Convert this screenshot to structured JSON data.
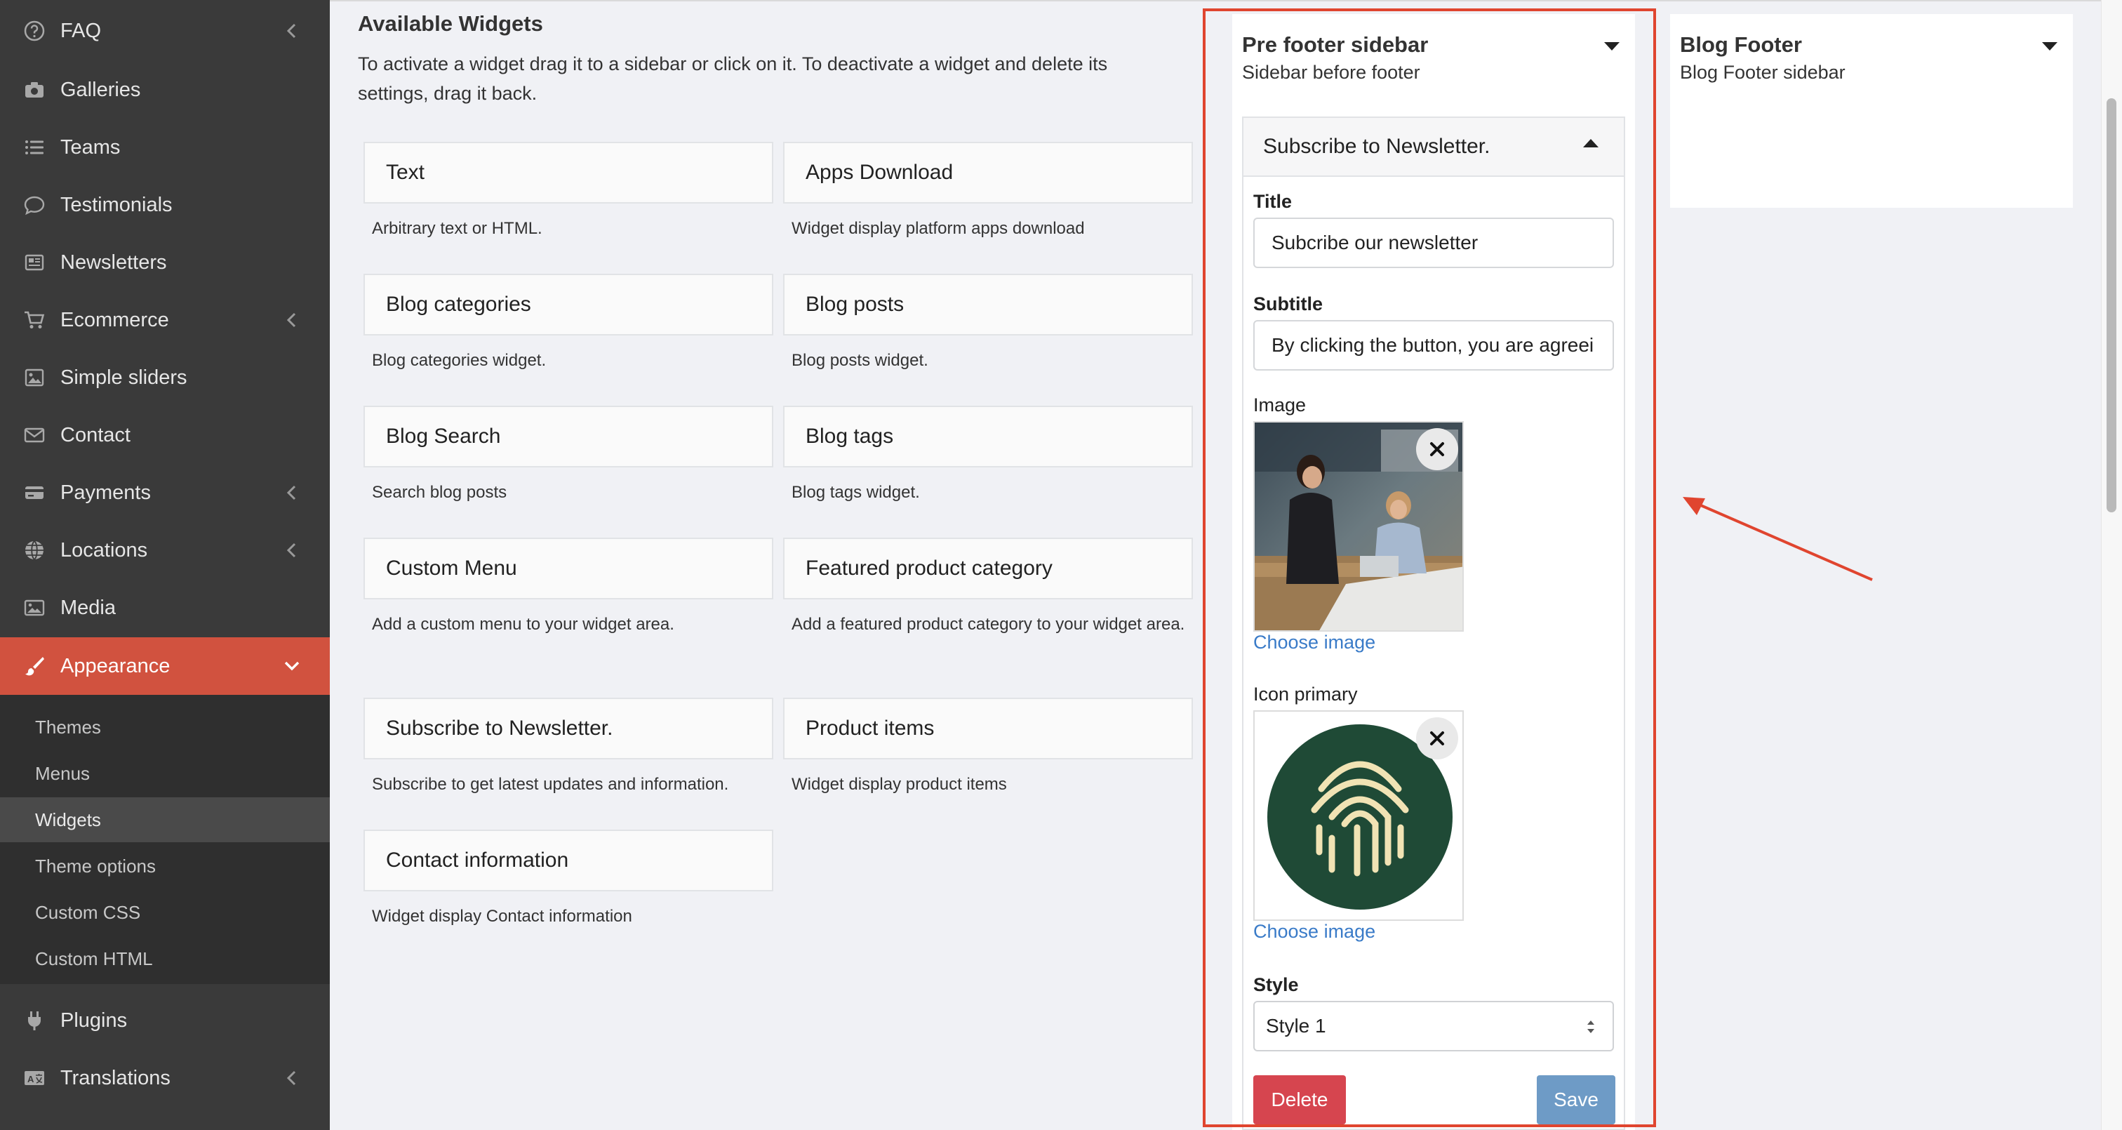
{
  "sidebar": {
    "items": [
      {
        "label": "FAQ",
        "icon": "question-circle-icon",
        "has_children": true
      },
      {
        "label": "Galleries",
        "icon": "camera-icon",
        "has_children": false
      },
      {
        "label": "Teams",
        "icon": "list-icon",
        "has_children": false
      },
      {
        "label": "Testimonials",
        "icon": "comment-icon",
        "has_children": false
      },
      {
        "label": "Newsletters",
        "icon": "newspaper-icon",
        "has_children": false
      },
      {
        "label": "Ecommerce",
        "icon": "cart-icon",
        "has_children": true
      },
      {
        "label": "Simple sliders",
        "icon": "image-icon",
        "has_children": false
      },
      {
        "label": "Contact",
        "icon": "envelope-icon",
        "has_children": false
      },
      {
        "label": "Payments",
        "icon": "credit-card-icon",
        "has_children": true
      },
      {
        "label": "Locations",
        "icon": "globe-icon",
        "has_children": true
      },
      {
        "label": "Media",
        "icon": "images-icon",
        "has_children": false
      },
      {
        "label": "Appearance",
        "icon": "paintbrush-icon",
        "has_children": true,
        "active": true
      }
    ],
    "appearance_sub": [
      "Themes",
      "Menus",
      "Widgets",
      "Theme options",
      "Custom CSS",
      "Custom HTML"
    ],
    "active_sub": "Widgets",
    "after": [
      {
        "label": "Plugins",
        "icon": "plug-icon",
        "has_children": false
      },
      {
        "label": "Translations",
        "icon": "language-icon",
        "has_children": true
      }
    ]
  },
  "available": {
    "title": "Available Widgets",
    "description": "To activate a widget drag it to a sidebar or click on it. To deactivate a widget and delete its settings, drag it back.",
    "widgets": [
      {
        "name": "Text",
        "desc": "Arbitrary text or HTML."
      },
      {
        "name": "Apps Download",
        "desc": "Widget display platform apps download"
      },
      {
        "name": "Blog categories",
        "desc": "Blog categories widget."
      },
      {
        "name": "Blog posts",
        "desc": "Blog posts widget."
      },
      {
        "name": "Blog Search",
        "desc": "Search blog posts"
      },
      {
        "name": "Blog tags",
        "desc": "Blog tags widget."
      },
      {
        "name": "Custom Menu",
        "desc": "Add a custom menu to your widget area."
      },
      {
        "name": "Featured product category",
        "desc": "Add a featured product category to your widget area."
      },
      {
        "name": "Subscribe to Newsletter.",
        "desc": "Subscribe to get latest updates and information."
      },
      {
        "name": "Product items",
        "desc": "Widget display product items"
      },
      {
        "name": "Contact information",
        "desc": "Widget display Contact information"
      }
    ]
  },
  "prefooter": {
    "title": "Pre footer sidebar",
    "subtitle": "Sidebar before footer",
    "widget": {
      "header": "Subscribe to Newsletter.",
      "title_label": "Title",
      "title_value": "Subcribe our newsletter",
      "subtitle_label": "Subtitle",
      "subtitle_value": "By clicking the button, you are agreei",
      "image_label": "Image",
      "choose_image": "Choose image",
      "icon_label": "Icon primary",
      "style_label": "Style",
      "style_value": "Style 1",
      "delete_label": "Delete",
      "save_label": "Save"
    }
  },
  "blogfooter": {
    "title": "Blog Footer",
    "subtitle": "Blog Footer sidebar"
  },
  "colors": {
    "sidebar_bg": "#3a3a3a",
    "active_accent": "#d1523f",
    "highlight_outline": "#e0452f",
    "link": "#3a7bc8",
    "delete": "#d6454f",
    "save": "#6e9bc6"
  }
}
